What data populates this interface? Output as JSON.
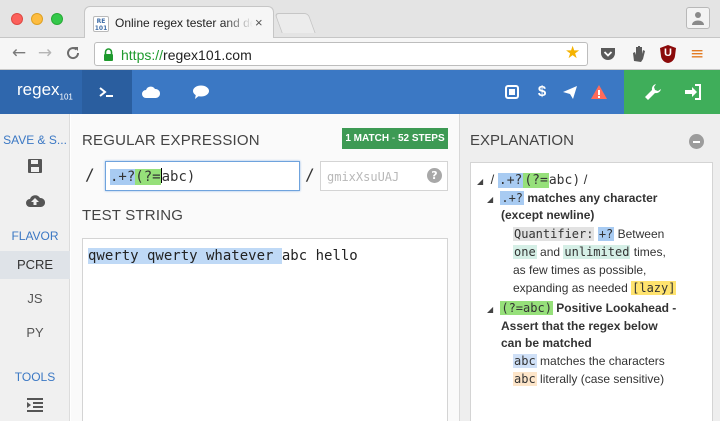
{
  "browser": {
    "tab_favicon": "RE 101",
    "tab_title": "Online regex tester and de",
    "tab_close": "×",
    "url_scheme": "https://",
    "url_host": "regex101.com",
    "ext_badge": "U"
  },
  "app": {
    "logo_main": "regex",
    "logo_sub": "101",
    "nav_tabs": [
      "terminal-icon",
      "cloud-icon",
      "chat-icon"
    ],
    "accent": "#3b78c4",
    "accent_green": "#3fae5a"
  },
  "sidebar": {
    "save_heading": "SAVE & S...",
    "flavor_heading": "FLAVOR",
    "flavors": [
      "PCRE",
      "JS",
      "PY"
    ],
    "tools_heading": "TOOLS"
  },
  "regex_section": {
    "title": "REGULAR EXPRESSION",
    "badge_count": "1 MATCH",
    "badge_sep": " - ",
    "badge_steps": "52 STEPS",
    "delimiter_open": "/",
    "delimiter_close": "/",
    "regex_part1": ".+?",
    "regex_part2": "(?=",
    "regex_part3": "abc)",
    "flags_placeholder": "gmixXsuUAJ",
    "help_label": "?"
  },
  "test_section": {
    "title": "TEST STRING",
    "matched_text": "qwerty qwerty whatever ",
    "rest_text": "abc hello"
  },
  "explanation": {
    "title": "EXPLANATION",
    "root_open": "/",
    "root_tok1": ".+?",
    "root_tok2": "(?=",
    "root_tok3": "abc)",
    "root_close": "/",
    "item1_tok": ".+?",
    "item1_desc": "matches any character",
    "item1_desc2": "(except newline)",
    "quant_label": "Quantifier:",
    "quant_tok": "+?",
    "quant_between": "Between",
    "quant_one": "one",
    "quant_and": "and",
    "quant_unlimited": "unlimited",
    "quant_times": "times,",
    "quant_line3": "as few times as possible,",
    "quant_line4": "expanding as needed",
    "quant_lazy": "[lazy]",
    "item2_tok": "(?=abc)",
    "item2_desc": "Positive Lookahead -",
    "item2_desc2": "Assert that the regex below",
    "item2_desc3": "can be matched",
    "sub1_tok": "abc",
    "sub1_desc": "matches the characters",
    "sub2_tok": "abc",
    "sub2_desc": "literally (case sensitive)"
  }
}
